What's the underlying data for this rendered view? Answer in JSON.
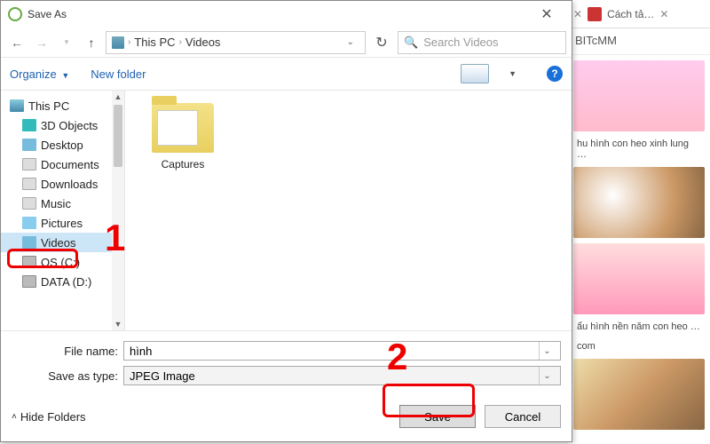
{
  "dialog": {
    "title": "Save As",
    "address": {
      "root": "This PC",
      "folder": "Videos"
    },
    "search_placeholder": "Search Videos",
    "toolbar": {
      "organize": "Organize",
      "newfolder": "New folder"
    },
    "tree": {
      "pc": "This PC",
      "items": [
        "3D Objects",
        "Desktop",
        "Documents",
        "Downloads",
        "Music",
        "Pictures",
        "Videos",
        "OS (C:)",
        "DATA (D:)"
      ]
    },
    "content": {
      "folder_label": "Captures"
    },
    "form": {
      "filename_label": "File name:",
      "filename_value": "hình",
      "type_label": "Save as type:",
      "type_value": "JPEG Image"
    },
    "footer": {
      "hide": "Hide Folders",
      "save": "Save",
      "cancel": "Cancel"
    }
  },
  "browser": {
    "tab_label": "Cách tả…",
    "address_frag": "BITcMM",
    "cap1": "hu hình con heo xinh lung …",
    "cap2": "ẩu hình nền năm con heo …",
    "cap2b": "com"
  },
  "annotations": {
    "n1": "1",
    "n2": "2"
  }
}
